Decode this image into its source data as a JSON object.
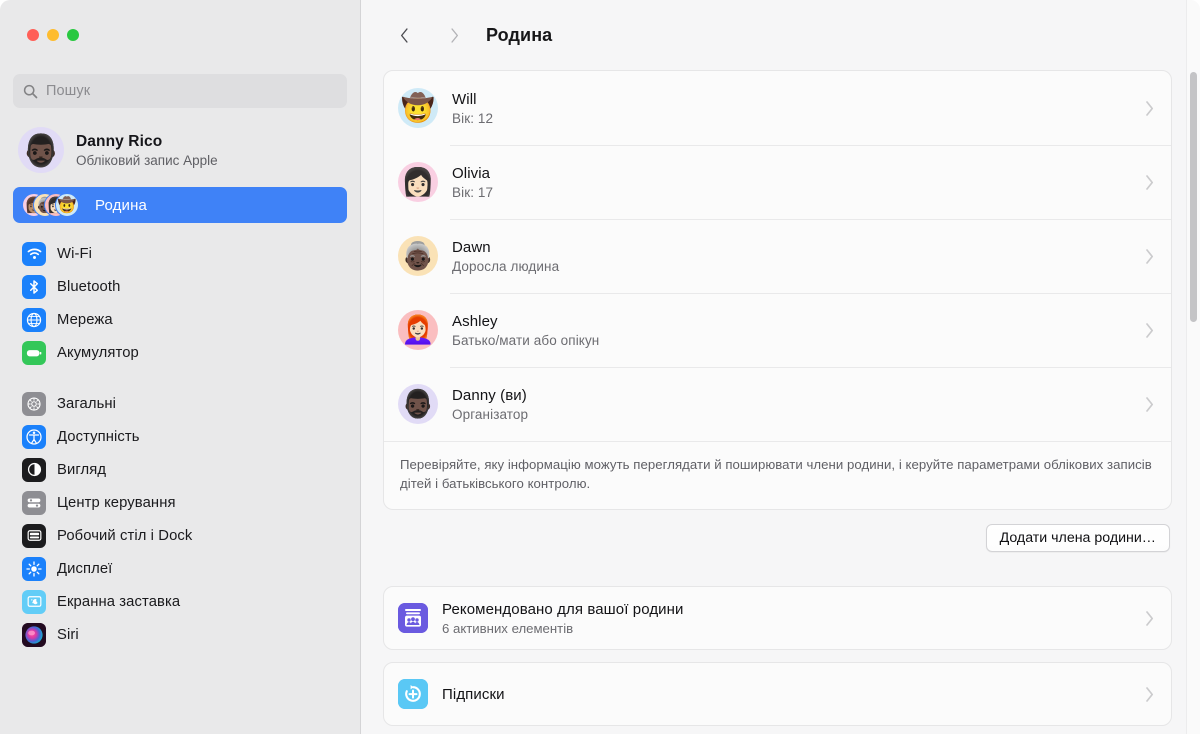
{
  "window": {
    "traffic_lights": [
      {
        "name": "close",
        "color": "#ff5f57"
      },
      {
        "name": "minimize",
        "color": "#febc2e"
      },
      {
        "name": "zoom",
        "color": "#28c840"
      }
    ]
  },
  "search": {
    "placeholder": "Пошук",
    "value": "",
    "icon": "search-icon"
  },
  "account": {
    "name": "Danny Rico",
    "subtitle": "Обліковий запис Apple",
    "avatar": "🧔🏿‍♂️"
  },
  "family_nav": {
    "label": "Родина",
    "selected": true,
    "accent": "#3f82f7",
    "avatars": [
      "👩🏽",
      "👵🏿",
      "👩🏻",
      "🤠"
    ]
  },
  "sidebar": {
    "groups": [
      {
        "items": [
          {
            "label": "Wi-Fi",
            "icon": "wifi-icon",
            "color": "#1b81fb"
          },
          {
            "label": "Bluetooth",
            "icon": "bluetooth-icon",
            "color": "#1b81fb"
          },
          {
            "label": "Мережа",
            "icon": "globe-icon",
            "color": "#1b81fb"
          },
          {
            "label": "Акумулятор",
            "icon": "battery-icon",
            "color": "#34c759"
          }
        ]
      },
      {
        "items": [
          {
            "label": "Загальні",
            "icon": "gear-icon",
            "color": "#8e8e93"
          },
          {
            "label": "Доступність",
            "icon": "accessibility-icon",
            "color": "#1b81fb"
          },
          {
            "label": "Вигляд",
            "icon": "appearance-icon",
            "color": "#1c1c1e"
          },
          {
            "label": "Центр керування",
            "icon": "control-center-icon",
            "color": "#8e8e93"
          },
          {
            "label": "Робочий стіл і Dock",
            "icon": "desktop-dock-icon",
            "color": "#1c1c1e"
          },
          {
            "label": "Дисплеї",
            "icon": "display-icon",
            "color": "#1b81fb"
          },
          {
            "label": "Екранна заставка",
            "icon": "screensaver-icon",
            "color": "#62cdf7"
          },
          {
            "label": "Siri",
            "icon": "siri-icon",
            "color": "#c6339a"
          }
        ]
      }
    ]
  },
  "header": {
    "back_icon": "chevron-left-icon",
    "forward_icon": "chevron-right-icon",
    "title": "Родина"
  },
  "family_members": [
    {
      "name": "Will",
      "detail": "Вік: 12",
      "avatar": "🤠",
      "avatar_bg": "#cfeaf7"
    },
    {
      "name": "Olivia",
      "detail": "Вік: 17",
      "avatar": "👩🏻",
      "avatar_bg": "#f9cfe2"
    },
    {
      "name": "Dawn",
      "detail": "Доросла людина",
      "avatar": "👵🏿",
      "avatar_bg": "#fae2b6"
    },
    {
      "name": "Ashley",
      "detail": "Батько/мати або опікун",
      "avatar": "👩🏻‍🦰",
      "avatar_bg": "#fabec0"
    },
    {
      "name": "Danny (ви)",
      "detail": "Організатор",
      "avatar": "🧔🏿‍♂️",
      "avatar_bg": "#e1dbf6"
    }
  ],
  "family_note": "Перевіряйте, яку інформацію можуть переглядати й поширювати члени родини, і керуйте параметрами облікових записів дітей і батьківського контролю.",
  "add_member_button": "Додати члена родини…",
  "feature_rows": [
    {
      "title": "Рекомендовано для вашої родини",
      "subtitle": "6 активних елементів",
      "icon": "family-recommendations-icon",
      "icon_color": "#6a5ae0"
    },
    {
      "title": "Підписки",
      "subtitle": "",
      "icon": "subscriptions-icon",
      "icon_color": "#5ac8f5"
    }
  ]
}
